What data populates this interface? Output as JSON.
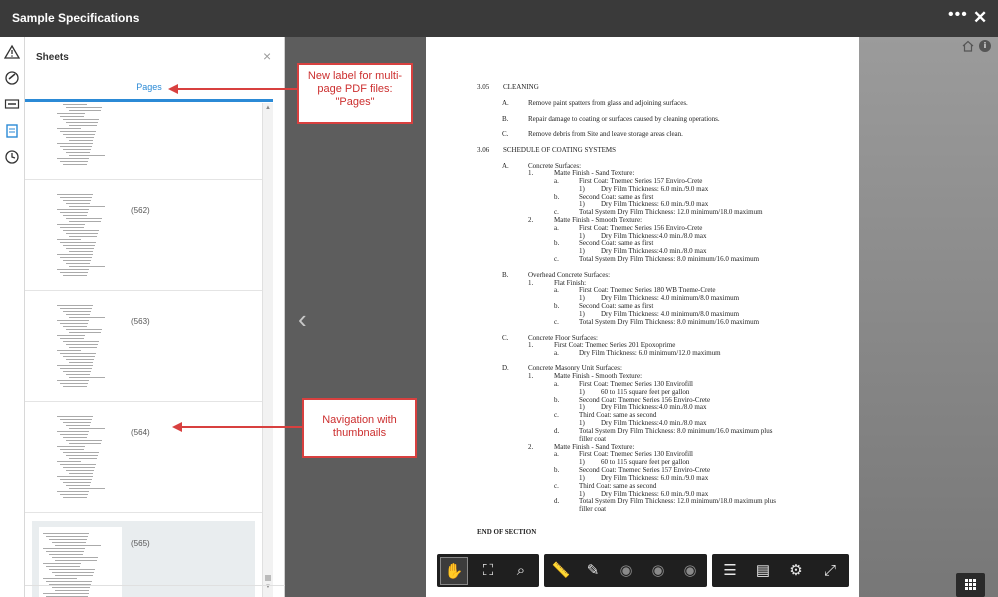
{
  "app": {
    "title": "Sample Specifications",
    "more_glyph": "•••",
    "close_glyph": "✕"
  },
  "rail": {
    "icons": [
      "warning-icon",
      "markup-icon",
      "rfi-icon",
      "sheets-icon",
      "history-icon"
    ]
  },
  "panel": {
    "title": "Sheets",
    "close_glyph": "×",
    "tab_label": "Pages",
    "pages": [
      {
        "label": ""
      },
      {
        "label": "(562)"
      },
      {
        "label": "(563)"
      },
      {
        "label": "(564)"
      },
      {
        "label": "(565)",
        "selected": true
      }
    ]
  },
  "callouts": {
    "label_note": "New label for multi-page PDF files: \"Pages\"",
    "nav_note": "Navigation with thumbnails"
  },
  "viewer": {
    "prev_glyph": "‹",
    "info_glyph": "i"
  },
  "document": {
    "lines": [
      "3.05",
      "CLEANING",
      "A.",
      "Remove paint spatters from glass and adjoining surfaces.",
      "B.",
      "Repair damage to coating or surfaces caused by cleaning operations.",
      "C.",
      "Remove debris from Site and leave storage areas clean.",
      "3.06",
      "SCHEDULE OF COATING SYSTEMS",
      "A.",
      "Concrete Surfaces:",
      "1.",
      "Matte Finish - Sand Texture:",
      "a.",
      "First Coat:  Tnemec Series 157 Enviro-Crete",
      "1)",
      "Dry Film Thickness: 6.0 min./9.0 max",
      "b.",
      "Second Coat:  same as first",
      "1)",
      "Dry Film Thickness: 6.0 min./9.0 max",
      "c.",
      "Total System Dry Film Thickness:  12.0 minimum/18.0 maximum",
      "2.",
      "Matte Finish - Smooth Texture:",
      "a.",
      "First Coat:  Tnemec Series 156 Enviro-Crete",
      "1)",
      "Dry Film Thickness:4.0 min./8.0 max",
      "b.",
      "Second Coat:  same as first",
      "1)",
      "Dry Film Thickness:4.0 min./8.0 max",
      "c.",
      "Total System Dry Film Thickness:  8.0 minimum/16.0 maximum",
      "B.",
      "Overhead Concrete Surfaces:",
      "1.",
      "Flat Finish:",
      "a.",
      "First Coat:  Tnemec Series 180 WB Tneme-Crete",
      "1)",
      "Dry Film Thickness:  4.0 minimum/8.0 maximum",
      "b.",
      "Second Coat:  same as first",
      "1)",
      "Dry Film Thickness:  4.0 minimum/8.0 maximum",
      "c.",
      "Total System Dry Film Thickness:  8.0 minimum/16.0 maximum",
      "C.",
      "Concrete Floor Surfaces:",
      "1.",
      "First Coat:  Tnemec Series 201 Epoxoprime",
      "a.",
      "Dry Film Thickness:  6.0 minimum/12.0 maximum",
      "D.",
      "Concrete Masonry Unit Surfaces:",
      "1.",
      "Matte Finish - Smooth Texture:",
      "a.",
      "First Coat:  Tnemec Series 130 Envirofill",
      "1)",
      "60 to 115 square feet per gallon",
      "b.",
      "Second Coat:  Tnemec Series 156 Enviro-Crete",
      "1)",
      "Dry Film Thickness:4.0 min./8.0 max",
      "c.",
      "Third Coat:  same as second",
      "1)",
      "Dry Film Thickness:4.0 min./8.0 max",
      "d.",
      "Total  System  Dry  Film  Thickness:    8.0  minimum/16.0  maximum  plus",
      "",
      "filler coat",
      "2.",
      "Matte Finish - Sand Texture:",
      "a.",
      "First Coat:  Tnemec Series 130 Envirofill",
      "1)",
      "60 to 115 square feet per gallon",
      "b.",
      "Second Coat:  Tnemec Series 157 Enviro-Crete",
      "1)",
      "Dry Film Thickness: 6.0 min./9.0 max",
      "c.",
      "Third Coat:  same as second",
      "1)",
      "Dry Film Thickness: 6.0 min./9.0 max",
      "d.",
      "Total  System  Dry  Film  Thickness:   12.0  minimum/18.0  maximum  plus",
      "",
      "filler coat",
      "",
      "END OF SECTION"
    ]
  },
  "toolbar": {
    "groups": [
      [
        "pan-tool",
        "zoom-fit",
        "zoom-area"
      ],
      [
        "measure",
        "markup",
        "visibility-1",
        "visibility-2",
        "visibility-3"
      ],
      [
        "layers",
        "sheet-info",
        "settings",
        "fullscreen"
      ]
    ]
  }
}
